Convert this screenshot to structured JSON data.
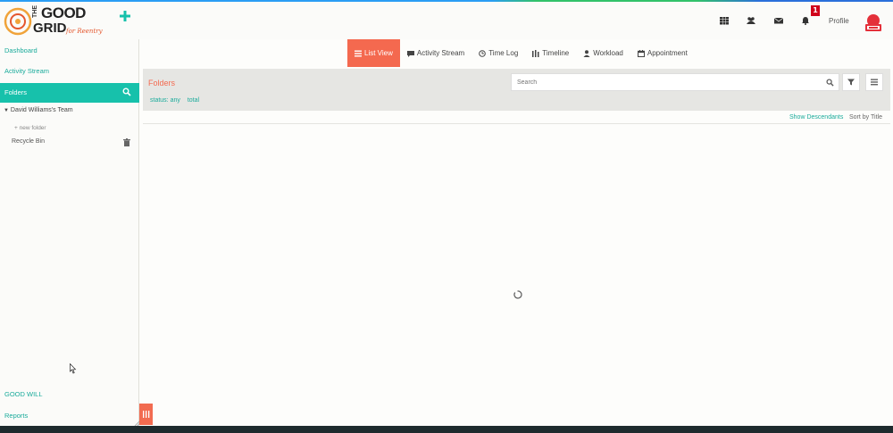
{
  "brand": {
    "logo_line1": "THE",
    "logo_line2": "GOOD",
    "logo_line3": "GRID",
    "logo_tagline": "for Reentry",
    "accent": "#17c1ab",
    "active_tab_color": "#f4694f"
  },
  "header": {
    "icons": [
      "grid-icon",
      "people-icon",
      "mail-icon",
      "bell-icon"
    ],
    "notification_count": "1",
    "profile_label": "Profile"
  },
  "sidebar": {
    "dashboard": "Dashboard",
    "activity_stream": "Activity Stream",
    "folders": "Folders",
    "team": "David Williams's Team",
    "new_folder": "+ new folder",
    "recycle_bin": "Recycle Bin",
    "good_will": "GOOD WILL",
    "reports": "Reports"
  },
  "tabs": [
    {
      "label": "List View",
      "icon": "list-icon",
      "active": true
    },
    {
      "label": "Activity Stream",
      "icon": "comment-icon",
      "active": false
    },
    {
      "label": "Time Log",
      "icon": "clock-icon",
      "active": false
    },
    {
      "label": "Timeline",
      "icon": "timeline-icon",
      "active": false
    },
    {
      "label": "Workload",
      "icon": "user-icon",
      "active": false
    },
    {
      "label": "Appointment",
      "icon": "calendar-icon",
      "active": false
    }
  ],
  "toolbar": {
    "title": "Folders",
    "search_placeholder": "Search",
    "status_filter": "status: any",
    "total": "total"
  },
  "list_meta": {
    "show_descendants": "Show Descendants",
    "sort_by": "Sort by Title"
  }
}
